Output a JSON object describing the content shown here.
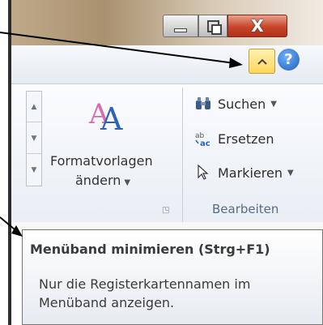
{
  "window_controls": {
    "close_label": "X"
  },
  "ribbon": {
    "help_label": "?",
    "styles_command": {
      "label_line1": "Formatvorlagen",
      "label_line2": "ändern",
      "icon": "aa-styles-icon"
    },
    "edit_group": {
      "title": "Bearbeiten",
      "commands": [
        {
          "label": "Suchen",
          "icon": "binoculars-icon"
        },
        {
          "label": "Ersetzen",
          "icon": "replace-icon"
        },
        {
          "label": "Markieren",
          "icon": "cursor-arrow-icon"
        }
      ]
    }
  },
  "tooltip": {
    "title": "Menüband minimieren (Strg+F1)",
    "description": "Nur die Registerkartennamen im Menüband anzeigen."
  },
  "colors": {
    "minimize_button_highlight": "#ffd65a",
    "close_button": "#c8442a",
    "group_label": "#596b82"
  }
}
